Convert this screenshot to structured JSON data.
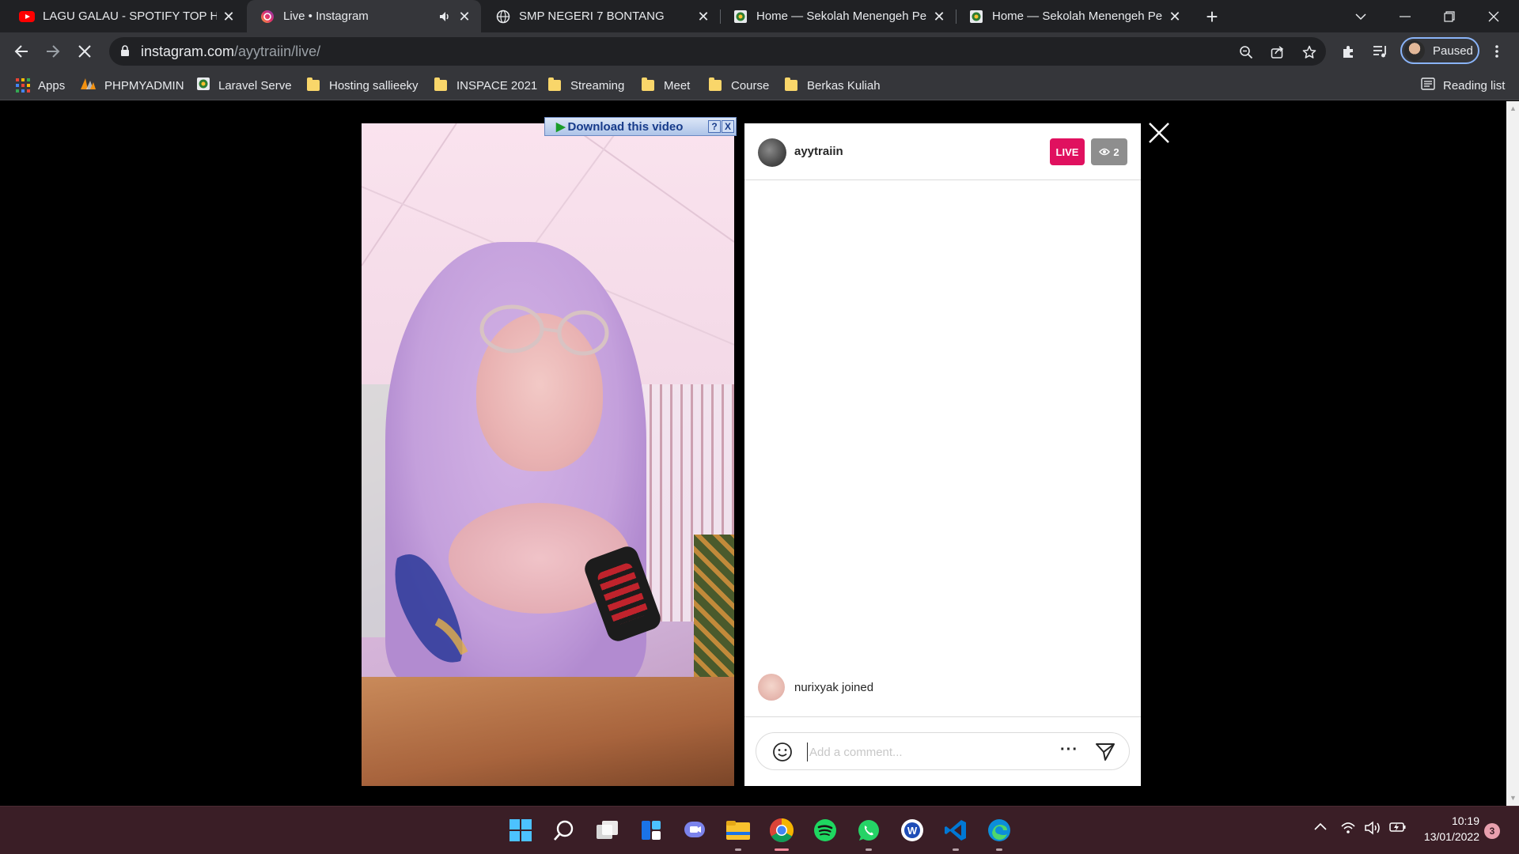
{
  "browser": {
    "tabs": [
      {
        "title": "LAGU GALAU - SPOTIFY TOP HIT",
        "favicon": "youtube-icon",
        "active": false
      },
      {
        "title": "Live • Instagram",
        "favicon": "instagram-icon",
        "active": true,
        "audio": true
      },
      {
        "title": "SMP NEGERI 7 BONTANG",
        "favicon": "globe-icon",
        "active": false
      },
      {
        "title": "Home — Sekolah Menengeh Per",
        "favicon": "school-logo-icon",
        "active": false
      },
      {
        "title": "Home — Sekolah Menengeh Per",
        "favicon": "school-logo-icon",
        "active": false
      }
    ],
    "url_host": "instagram.com",
    "url_path": "/ayytraiin/live/",
    "profile_label": "Paused",
    "bookmarks": [
      {
        "label": "Apps",
        "icon": "apps-grid-icon"
      },
      {
        "label": "PHPMYADMIN",
        "icon": "phpmyadmin-icon"
      },
      {
        "label": "Laravel Serve",
        "icon": "school-logo-icon"
      },
      {
        "label": "Hosting sallieeky",
        "icon": "folder-icon"
      },
      {
        "label": "INSPACE 2021",
        "icon": "folder-icon"
      },
      {
        "label": "Streaming",
        "icon": "folder-icon"
      },
      {
        "label": "Meet",
        "icon": "folder-icon"
      },
      {
        "label": "Course",
        "icon": "folder-icon"
      },
      {
        "label": "Berkas Kuliah",
        "icon": "folder-icon"
      }
    ],
    "reading_list": "Reading list"
  },
  "live": {
    "download_label": "Download this video",
    "download_help": "?",
    "download_close": "X",
    "username": "ayytraiin",
    "live_badge": "LIVE",
    "viewer_count": "2",
    "comments": [
      {
        "user": "nurixyak",
        "text": "nurixyak joined"
      }
    ],
    "comment_placeholder": "Add a comment...",
    "more_label": "···"
  },
  "taskbar": {
    "apps": [
      "windows-start-icon",
      "search-icon",
      "task-view-icon",
      "widgets-icon",
      "teams-chat-icon",
      "file-explorer-icon",
      "chrome-icon",
      "spotify-icon",
      "whatsapp-icon",
      "word-app-icon",
      "vscode-icon",
      "edge-icon"
    ],
    "time": "10:19",
    "date": "13/01/2022",
    "notification_count": "3"
  },
  "colors": {
    "live": "#e0115f",
    "chrome_dark": "#202124",
    "chrome_toolbar": "#35363a",
    "taskbar": "#3a1e26"
  }
}
